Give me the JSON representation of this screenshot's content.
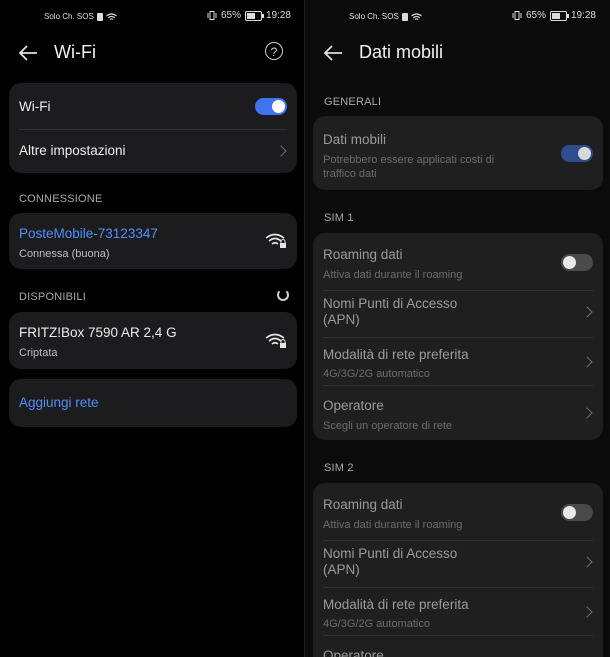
{
  "statusbar": {
    "carrier": "Solo Ch. SOS",
    "battery_pct": "65%",
    "time": "19:28"
  },
  "wifi_screen": {
    "title": "Wi-Fi",
    "toggle_label": "Wi-Fi",
    "toggle_on": true,
    "more_settings": "Altre impostazioni",
    "section_connection": "CONNESSIONE",
    "connected_network": {
      "name": "PosteMobile-73123347",
      "status": "Connessa (buona)"
    },
    "section_available": "DISPONIBILI",
    "available_networks": [
      {
        "name": "FRITZ!Box 7590 AR 2,4 G",
        "status": "Criptata"
      }
    ],
    "add_network": "Aggiungi rete"
  },
  "mobile_screen": {
    "title": "Dati mobili",
    "section_general": "GENERALI",
    "mobile_data": {
      "title": "Dati mobili",
      "subtitle": "Potrebbero essere applicati costi di traffico dati",
      "toggle_on": true
    },
    "sim1": {
      "label": "SIM 1",
      "roaming_title": "Roaming dati",
      "roaming_sub": "Attiva dati durante il roaming",
      "apn_title": "Nomi Punti di Accesso (APN)",
      "network_mode_title": "Modalità di rete preferita",
      "network_mode_sub": "4G/3G/2G automatico",
      "operator_title": "Operatore",
      "operator_sub": "Scegli un operatore di rete"
    },
    "sim2": {
      "label": "SIM 2",
      "roaming_title": "Roaming dati",
      "roaming_sub": "Attiva dati durante il roaming",
      "apn_title": "Nomi Punti di Accesso (APN)",
      "network_mode_title": "Modalità di rete preferita",
      "network_mode_sub": "4G/3G/2G automatico",
      "operator_title": "Operatore"
    }
  },
  "colors": {
    "accent": "#3e74f2",
    "link": "#4f8ff7",
    "card": "#1c1c1e",
    "background": "#000000"
  }
}
